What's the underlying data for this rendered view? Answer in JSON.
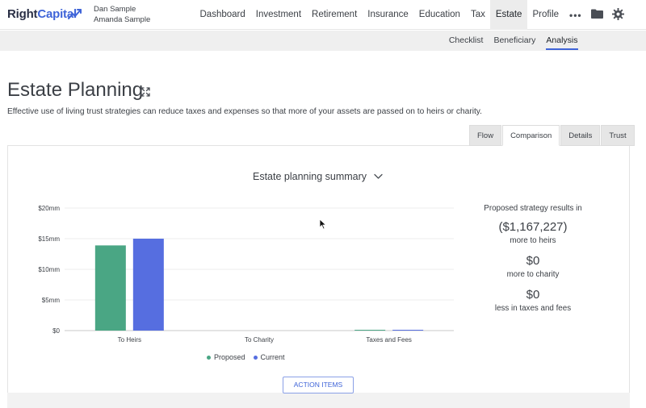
{
  "brand": {
    "name_a": "Right",
    "name_b": "Capital"
  },
  "users": {
    "primary": "Dan Sample",
    "secondary": "Amanda Sample"
  },
  "nav": {
    "items": [
      {
        "label": "Dashboard"
      },
      {
        "label": "Investment"
      },
      {
        "label": "Retirement"
      },
      {
        "label": "Insurance"
      },
      {
        "label": "Education"
      },
      {
        "label": "Tax"
      },
      {
        "label": "Estate"
      },
      {
        "label": "Profile"
      }
    ],
    "active": "Estate",
    "more": "•••"
  },
  "subnav": {
    "items": [
      {
        "label": "Checklist"
      },
      {
        "label": "Beneficiary"
      },
      {
        "label": "Analysis"
      }
    ],
    "active": "Analysis"
  },
  "page": {
    "title": "Estate Planning",
    "description": "Effective use of living trust strategies can reduce taxes and expenses so that more of your assets are passed on to heirs or charity."
  },
  "tabs": {
    "items": [
      {
        "label": "Flow"
      },
      {
        "label": "Comparison"
      },
      {
        "label": "Details"
      },
      {
        "label": "Trust"
      }
    ],
    "active": "Comparison"
  },
  "summary": {
    "title": "Estate planning summary"
  },
  "chart_data": {
    "type": "bar",
    "categories": [
      "To Heirs",
      "To Charity",
      "Taxes and Fees"
    ],
    "series": [
      {
        "name": "Proposed",
        "color": "#4aa684",
        "values": [
          13.9,
          0,
          0.05
        ]
      },
      {
        "name": "Current",
        "color": "#566ee0",
        "values": [
          15.0,
          0,
          0.05
        ]
      }
    ],
    "ylim": [
      0,
      20
    ],
    "yticks": [
      0,
      5,
      10,
      15,
      20
    ],
    "ytick_labels": [
      "$0",
      "$5mm",
      "$10mm",
      "$15mm",
      "$20mm"
    ],
    "grid": true,
    "legend_position": "bottom"
  },
  "results": {
    "heading": "Proposed strategy results in",
    "items": [
      {
        "value": "($1,167,227)",
        "label": "more to heirs"
      },
      {
        "value": "$0",
        "label": "more to charity"
      },
      {
        "value": "$0",
        "label": "less in taxes and fees"
      }
    ]
  },
  "actions": {
    "action_items_label": "ACTION ITEMS"
  },
  "colors": {
    "accent": "#3f64d8",
    "proposed": "#4aa684",
    "current": "#566ee0"
  }
}
